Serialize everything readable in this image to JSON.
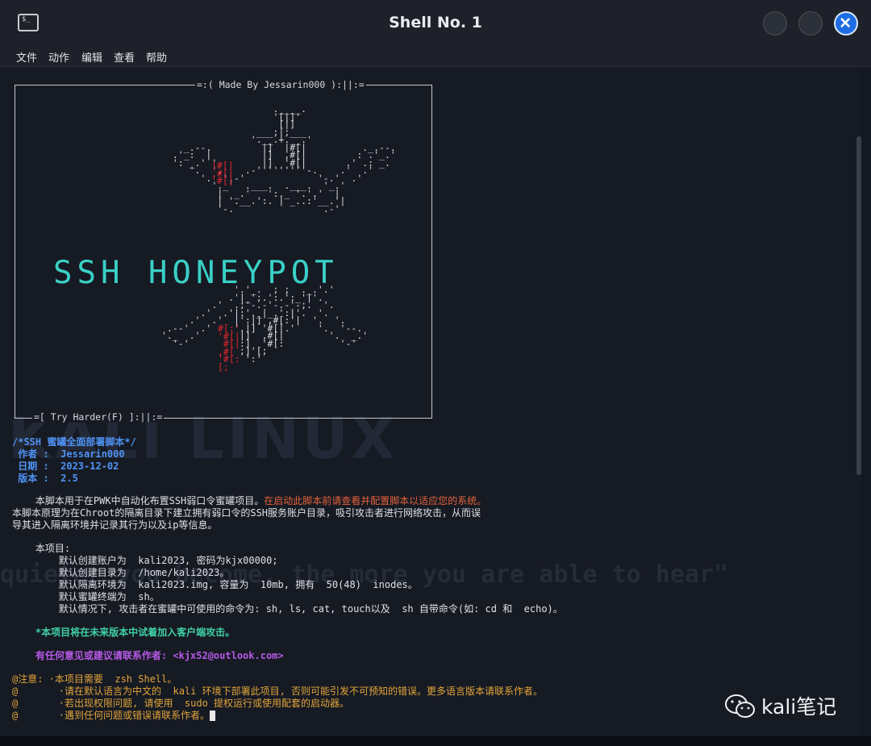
{
  "window": {
    "title": "Shell No. 1"
  },
  "menu": [
    "文件",
    "动作",
    "编辑",
    "查看",
    "帮助"
  ],
  "box": {
    "top_label": "=:( Made By Jessarin000 ):||:=",
    "bottom_label": "=[ Try Harder(F) ]:||:="
  },
  "art": {
    "title": "SSH HONEYPOT"
  },
  "background": {
    "logo_text": "KALI LINUX",
    "quote": "quieter you become, the more you are able to hear\""
  },
  "header": {
    "comment": "/*SSH 蜜罐全面部署脚本*/",
    "author_label": " 作者 :  Jessarin000",
    "date_label": " 日期 :  2023-12-02",
    "version_label": " 版本 :  2.5"
  },
  "desc": {
    "line1_white": "    本脚本用于在PWK中自动化布置SSH弱口令蜜罐项目。",
    "line1_red": "在启动此脚本前请查看并配置脚本以适应您的系统。",
    "line2": "本脚本原理为在Chroot的隔离目录下建立拥有弱口令的SSH服务账户目录，吸引攻击者进行网络攻击，从而误",
    "line3": "导其进入隔离环境并记录其行为以及ip等信息。"
  },
  "project": {
    "heading": "    本项目:",
    "items": [
      "        默认创建账户为  kali2023, 密码为kjx00000;",
      "        默认创建目录为  /home/kali2023。",
      "        默认隔离环境为  kali2023.img, 容量为  10mb, 拥有  50(48)  inodes。",
      "        默认蜜罐终端为  sh。",
      "        默认情况下, 攻击者在蜜罐中可使用的命令为: sh, ls, cat, touch以及  sh 自带命令(如: cd 和  echo)。"
    ]
  },
  "future": "    *本项目将在未来版本中试着加入客户端攻击。",
  "contact": "    有任何意见或建议请联系作者: <kjx52@outlook.com>",
  "notes": [
    "@注意: ·本项目需要  zsh Shell。",
    "@       ·请在默认语言为中文的  kali 环境下部署此项目, 否则可能引发不可预知的错误。更多语言版本请联系作者。",
    "@       ·若出现权限问题, 请使用  sudo 提权运行或使用配套的启动器。",
    "@       ·遇到任何问题或错误请联系作者。"
  ],
  "watermark": "kali笔记",
  "colors": {
    "accent": "#1e6ee3",
    "cyan": "#3ad0c7",
    "red": "#e0262d",
    "blue": "#4f93f5",
    "purple": "#b65ae8",
    "yellow": "#e3a53a"
  }
}
